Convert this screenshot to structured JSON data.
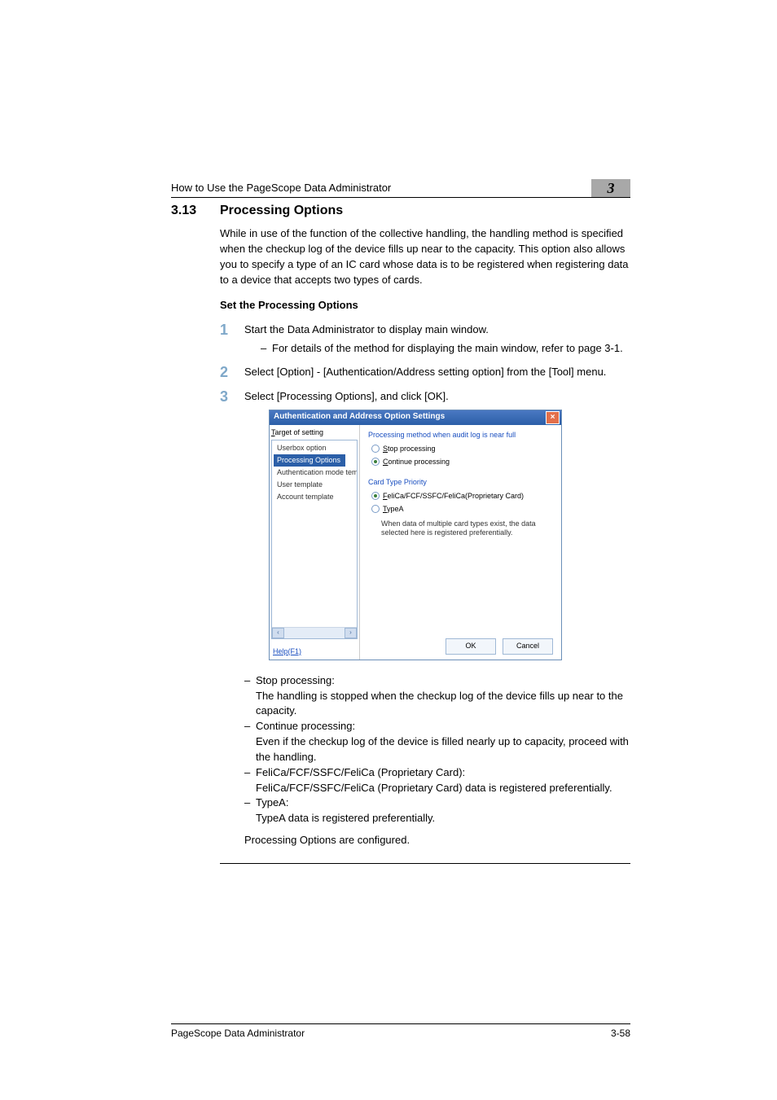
{
  "header": {
    "running_head": "How to Use the PageScope Data Administrator",
    "chapter_number": "3"
  },
  "section": {
    "number": "3.13",
    "title": "Processing Options",
    "intro": "While in use of the function of the collective handling, the handling method is specified when the checkup log of the device fills up near to the capacity. This option also allows you to specify a type of an IC card whose data is to be registered when registering data to a device that accepts two types of cards.",
    "subhead": "Set the Processing Options"
  },
  "steps": [
    {
      "num": "1",
      "text": "Start the Data Administrator to display main window.",
      "sub": [
        "For details of the method for displaying the main window, refer to page 3-1."
      ]
    },
    {
      "num": "2",
      "text": "Select [Option] - [Authentication/Address setting option] from the [Tool] menu."
    },
    {
      "num": "3",
      "text": "Select [Processing Options], and click [OK]."
    }
  ],
  "dialog": {
    "title": "Authentication and Address Option Settings",
    "left_label": "Target of setting",
    "tree": [
      {
        "label": "Userbox option",
        "selected": false
      },
      {
        "label": "Processing Options",
        "selected": true
      },
      {
        "label": "Authentication mode tem",
        "selected": false
      },
      {
        "label": "User template",
        "selected": false
      },
      {
        "label": "Account template",
        "selected": false
      }
    ],
    "help": "Help(F1)",
    "groups": [
      {
        "label": "Processing method when audit log is near full",
        "options": [
          {
            "letter": "S",
            "rest": "top processing",
            "selected": false
          },
          {
            "letter": "C",
            "rest": "ontinue processing",
            "selected": true
          }
        ]
      },
      {
        "label": "Card Type Priority",
        "options": [
          {
            "letter": "F",
            "rest": "eliCa/FCF/SSFC/FeliCa(Proprietary Card)",
            "selected": true
          },
          {
            "letter": "T",
            "rest": "ypeA",
            "selected": false
          }
        ],
        "hint": "When data of multiple card types exist, the data selected here is registered preferentially."
      }
    ],
    "buttons": {
      "ok": "OK",
      "cancel": "Cancel"
    }
  },
  "explanations": [
    {
      "term": "Stop processing:",
      "desc": "The handling is stopped when the checkup log of the device fills up near to the capacity."
    },
    {
      "term": "Continue processing:",
      "desc": "Even if the checkup log of the device is filled nearly up to capacity, proceed with the handling."
    },
    {
      "term": "FeliCa/FCF/SSFC/FeliCa (Proprietary Card):",
      "desc": "FeliCa/FCF/SSFC/FeliCa (Proprietary Card) data is registered preferentially."
    },
    {
      "term": "TypeA:",
      "desc": "TypeA data is registered preferentially."
    }
  ],
  "closing": "Processing Options are configured.",
  "footer": {
    "left": "PageScope Data Administrator",
    "right": "3-58"
  }
}
